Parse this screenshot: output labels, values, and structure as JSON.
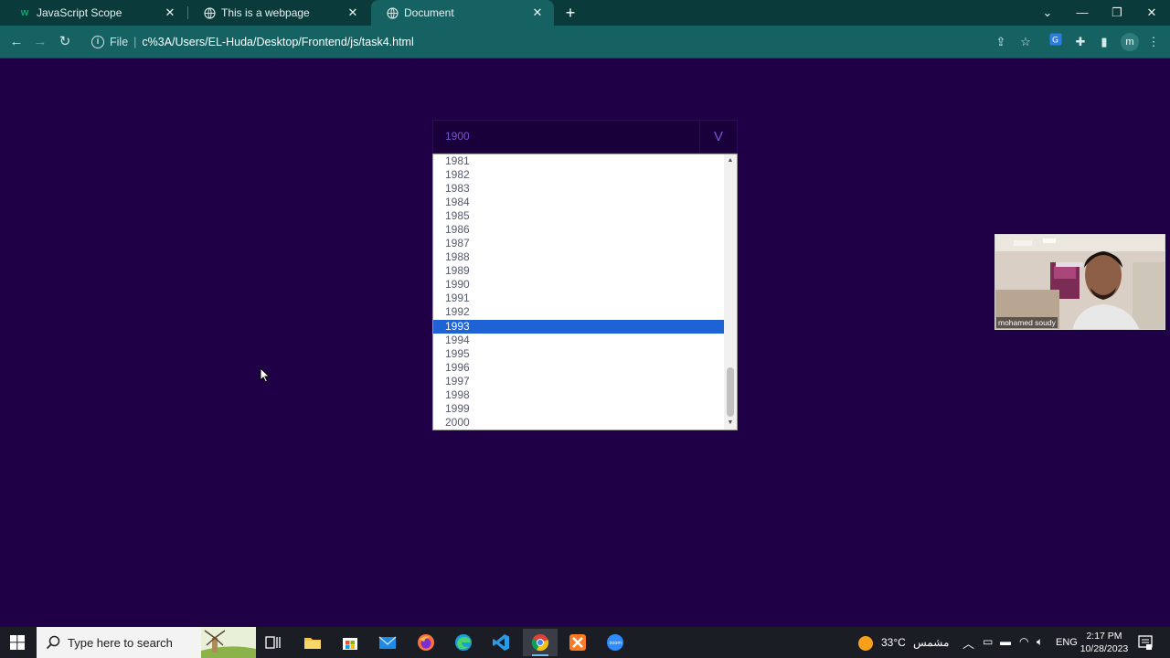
{
  "browser": {
    "tabs": [
      {
        "title": "JavaScript Scope",
        "favicon": "w3schools-icon"
      },
      {
        "title": "This is a webpage",
        "favicon": "globe-icon"
      },
      {
        "title": "Document",
        "favicon": "globe-icon"
      }
    ],
    "active_tab": 2,
    "address": {
      "scheme": "File",
      "url": "c%3A/Users/EL-Huda/Desktop/Frontend/js/task4.html"
    },
    "profile_initial": "m",
    "colors": {
      "frame": "#0b3a3a",
      "toolbar": "#166262"
    }
  },
  "page": {
    "background": "#1f0047",
    "select": {
      "value": "1900",
      "arrow": "V"
    },
    "options": [
      "1981",
      "1982",
      "1983",
      "1984",
      "1985",
      "1986",
      "1987",
      "1988",
      "1989",
      "1990",
      "1991",
      "1992",
      "1993",
      "1994",
      "1995",
      "1996",
      "1997",
      "1998",
      "1999",
      "2000"
    ],
    "selected_option": "1993",
    "colors": {
      "accent": "#7b52d6",
      "selected": "#1e63d6"
    }
  },
  "webcam": {
    "name": "mohamed soudy"
  },
  "taskbar": {
    "search_placeholder": "Type here to search",
    "weather_temp": "33°C",
    "weather_text": "مشمس",
    "language": "ENG",
    "time": "2:17 PM",
    "date": "10/28/2023"
  }
}
